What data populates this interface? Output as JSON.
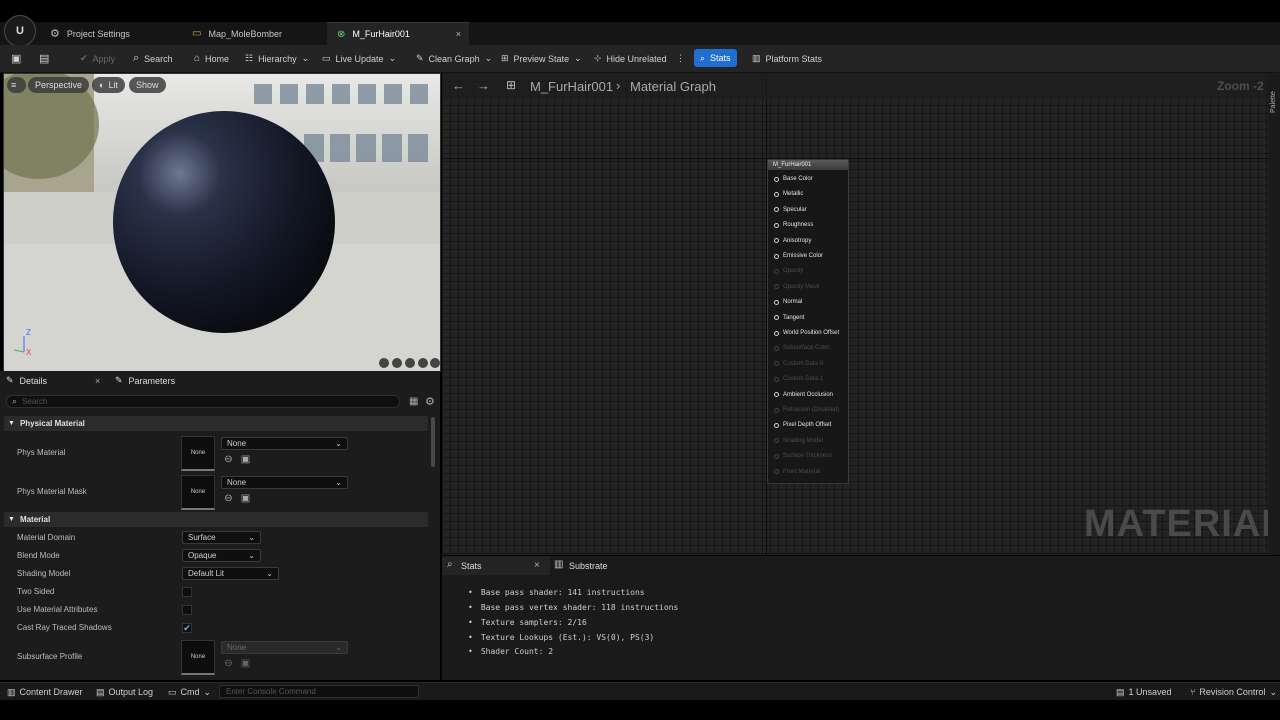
{
  "tabs": [
    {
      "label": "Project Settings"
    },
    {
      "label": "Map_MoleBomber"
    },
    {
      "label": "M_FurHair001"
    }
  ],
  "toolbar": {
    "apply": "Apply",
    "search": "Search",
    "home": "Home",
    "hierarchy": "Hierarchy",
    "live_update": "Live Update",
    "clean_graph": "Clean Graph",
    "preview_state": "Preview State",
    "hide_unrelated": "Hide Unrelated",
    "stats": "Stats",
    "platform_stats": "Platform Stats"
  },
  "viewport": {
    "perspective": "Perspective",
    "lit": "Lit",
    "show": "Show",
    "axis_z": "Z",
    "axis_x": "X"
  },
  "details": {
    "tab_details": "Details",
    "tab_parameters": "Parameters",
    "search_placeholder": "Search",
    "section_physical": "Physical Material",
    "phys_material": "Phys Material",
    "phys_material_mask": "Phys Material Mask",
    "none": "None",
    "section_material": "Material",
    "material_domain": "Material Domain",
    "material_domain_value": "Surface",
    "blend_mode": "Blend Mode",
    "blend_mode_value": "Opaque",
    "shading_model": "Shading Model",
    "shading_model_value": "Default Lit",
    "two_sided": "Two Sided",
    "use_material_attributes": "Use Material Attributes",
    "cast_ray_traced_shadows": "Cast Ray Traced Shadows",
    "subsurface_profile": "Subsurface Profile"
  },
  "graph": {
    "breadcrumb_asset": "M_FurHair001",
    "breadcrumb_graph": "Material Graph",
    "zoom": "Zoom -2",
    "palette": "Palette",
    "watermark": "MATERIAL",
    "node_title": "M_FurHair001",
    "pins": [
      {
        "label": "Base Color",
        "active": true
      },
      {
        "label": "Metallic",
        "active": true
      },
      {
        "label": "Specular",
        "active": true
      },
      {
        "label": "Roughness",
        "active": true
      },
      {
        "label": "Anisotropy",
        "active": true
      },
      {
        "label": "Emissive Color",
        "active": true
      },
      {
        "label": "Opacity",
        "active": false
      },
      {
        "label": "Opacity Mask",
        "active": false
      },
      {
        "label": "Normal",
        "active": true
      },
      {
        "label": "Tangent",
        "active": true
      },
      {
        "label": "World Position Offset",
        "active": true
      },
      {
        "label": "Subsurface Color",
        "active": false
      },
      {
        "label": "Custom Data 0",
        "active": false
      },
      {
        "label": "Custom Data 1",
        "active": false
      },
      {
        "label": "Ambient Occlusion",
        "active": true
      },
      {
        "label": "Refraction (Disabled)",
        "active": false
      },
      {
        "label": "Pixel Depth Offset",
        "active": true
      },
      {
        "label": "Shading Model",
        "active": false
      },
      {
        "label": "Surface Thickness",
        "active": false
      },
      {
        "label": "Front Material",
        "active": false
      }
    ]
  },
  "stats": {
    "tab_stats": "Stats",
    "tab_substrate": "Substrate",
    "lines": [
      "Base pass shader: 141 instructions",
      "Base pass vertex shader: 118 instructions",
      "Texture samplers: 2/16",
      "Texture Lookups (Est.): VS(0), PS(3)",
      "Shader Count: 2"
    ]
  },
  "bottombar": {
    "content_drawer": "Content Drawer",
    "output_log": "Output Log",
    "cmd": "Cmd",
    "console_placeholder": "Enter Console Command",
    "unsaved": "1 Unsaved",
    "revision_control": "Revision Control"
  },
  "colors": {
    "accent": "#1f6fcf",
    "panel": "#1c1c1c",
    "graph_bg": "#232323"
  }
}
